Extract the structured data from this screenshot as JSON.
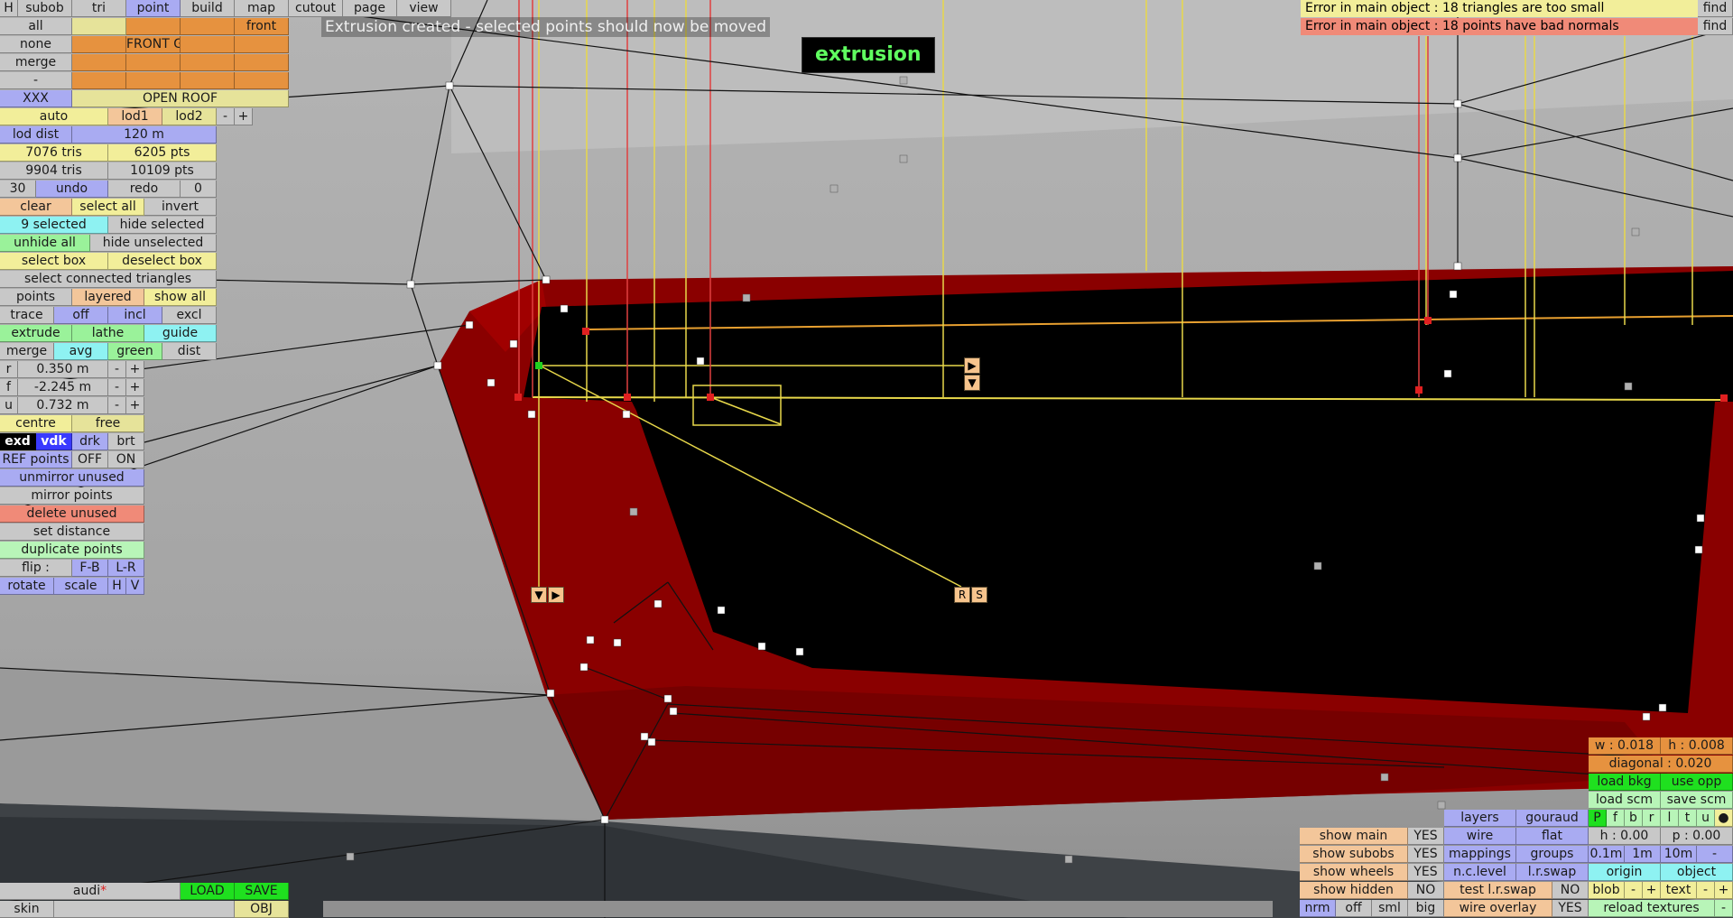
{
  "viewport": {
    "label": "3D model viewport"
  },
  "top_message": "Extrusion created - selected points should now be moved",
  "mode_badge": "extrusion",
  "errors": [
    {
      "text": "Error in main object : 18 triangles are too small",
      "button": "find"
    },
    {
      "text": "Error in main object : 18 points have bad normals",
      "button": "find"
    }
  ],
  "menu": {
    "h": "H",
    "subob": "subob",
    "tri": "tri",
    "point": "point",
    "build": "build",
    "map": "map",
    "cutout": "cutout",
    "page": "page",
    "view": "view"
  },
  "left": {
    "all": "all",
    "none": "none",
    "merge": "merge",
    "dash": "-",
    "xxx": "XXX",
    "front": "front",
    "front_g": "FRONT G",
    "open_roof": "OPEN ROOF",
    "auto": "auto",
    "lod1": "lod1",
    "lod2": "lod2",
    "minus": "-",
    "plus": "+",
    "lod_dist": "lod dist",
    "lod_dist_val": "120 m",
    "tris1": "7076 tris",
    "pts1": "6205 pts",
    "tris2": "9904 tris",
    "pts2": "10109 pts",
    "undo_n": "30",
    "undo": "undo",
    "redo": "redo",
    "redo_n": "0",
    "clear": "clear",
    "select_all": "select all",
    "invert": "invert",
    "selected": "9 selected",
    "hide_selected": "hide selected",
    "unhide_all": "unhide all",
    "hide_unselected": "hide unselected",
    "select_box": "select box",
    "deselect_box": "deselect box",
    "select_connected": "select connected triangles",
    "points": "points",
    "layered": "layered",
    "show_all": "show all",
    "trace": "trace",
    "off": "off",
    "incl": "incl",
    "excl": "excl",
    "extrude": "extrude",
    "lathe": "lathe",
    "guide": "guide",
    "merge2": "merge",
    "avg": "avg",
    "green": "green",
    "dist": "dist",
    "r": "r",
    "r_val": "0.350 m",
    "f": "f",
    "f_val": "-2.245 m",
    "u": "u",
    "u_val": "0.732 m",
    "centre": "centre",
    "free": "free",
    "exd": "exd",
    "vdk": "vdk",
    "drk": "drk",
    "brt": "brt",
    "ref_points": "REF points",
    "ref_off": "OFF",
    "ref_on": "ON",
    "unmirror": "unmirror unused",
    "mirror": "mirror points",
    "delete_unused": "delete unused",
    "set_distance": "set distance",
    "duplicate": "duplicate points",
    "flip": "flip :",
    "fb": "F-B",
    "lr": "L-R",
    "rotate": "rotate",
    "scale": "scale",
    "hh": "H",
    "vv": "V"
  },
  "bottom_left": {
    "name": "audi",
    "asterisk": "*",
    "load": "LOAD",
    "save": "SAVE",
    "skin": "skin",
    "obj": "OBJ"
  },
  "right": {
    "w": "w : 0.018",
    "h": "h : 0.008",
    "diagonal": "diagonal : 0.020",
    "load_bkg": "load bkg",
    "use_opp": "use opp",
    "load_scm": "load scm",
    "save_scm": "save scm",
    "layers": "layers",
    "gouraud": "gouraud",
    "wire": "wire",
    "flat": "flat",
    "mappings": "mappings",
    "groups": "groups",
    "nc_level": "n.c.level",
    "lr_swap": "l.r.swap",
    "test_lr": "test l.r.swap",
    "test_no": "NO",
    "wire_overlay": "wire overlay",
    "wire_yes": "YES",
    "show_main": "show main",
    "show_subobs": "show subobs",
    "show_wheels": "show wheels",
    "show_hidden": "show hidden",
    "yes": "YES",
    "no": "NO",
    "nrm": "nrm",
    "off": "off",
    "sml": "sml",
    "big": "big",
    "views": [
      "P",
      "f",
      "b",
      "r",
      "l",
      "t",
      "u"
    ],
    "dot": "●",
    "h0": "h : 0.00",
    "p0": "p : 0.00",
    "g01": "0.1m",
    "g1": "1m",
    "g10": "10m",
    "gminus": "-",
    "origin": "origin",
    "object": "object",
    "blob": "blob",
    "bminus": "-",
    "bplus": "+",
    "text": "text",
    "tminus": "-",
    "tplus": "+",
    "reload": "reload textures",
    "rminus": "-"
  },
  "handles": {
    "v": "▼",
    "r": "▶",
    "up": "▶",
    "down": "▼",
    "R": "R",
    "S": "S"
  }
}
